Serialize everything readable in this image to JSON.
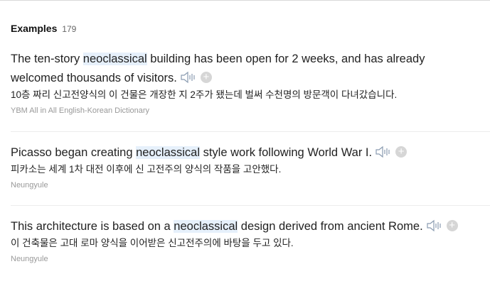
{
  "header": {
    "title": "Examples",
    "count": "179"
  },
  "examples": [
    {
      "en_before": "The ten-story ",
      "en_highlight": "neoclassical",
      "en_after": " building has been open for 2 weeks, and has already welcomed thousands of visitors.",
      "ko": "10층 짜리 신고전양식의 이 건물은 개장한 지 2주가 됐는데 벌써 수천명의 방문객이 다녀갔습니다.",
      "source": "YBM All in All English-Korean Dictionary"
    },
    {
      "en_before": "Picasso began creating ",
      "en_highlight": "neoclassical",
      "en_after": " style work following World War I.",
      "ko": "피카소는 세계 1차 대전 이후에 신 고전주의 양식의 작품을 고안했다.",
      "source": "Neungyule"
    },
    {
      "en_before": "This architecture is based on a ",
      "en_highlight": "neoclassical",
      "en_after": " design derived from ancient Rome.",
      "ko": "이 건축물은 고대 로마 양식을 이어받은 신고전주의에 바탕을 두고 있다.",
      "source": "Neungyule"
    }
  ],
  "icons": {
    "speaker": "speaker-icon",
    "add": "plus-circle-icon",
    "add_glyph": "+"
  },
  "colors": {
    "highlight": "#e6f0fb",
    "icon": "#8a9bb0"
  }
}
